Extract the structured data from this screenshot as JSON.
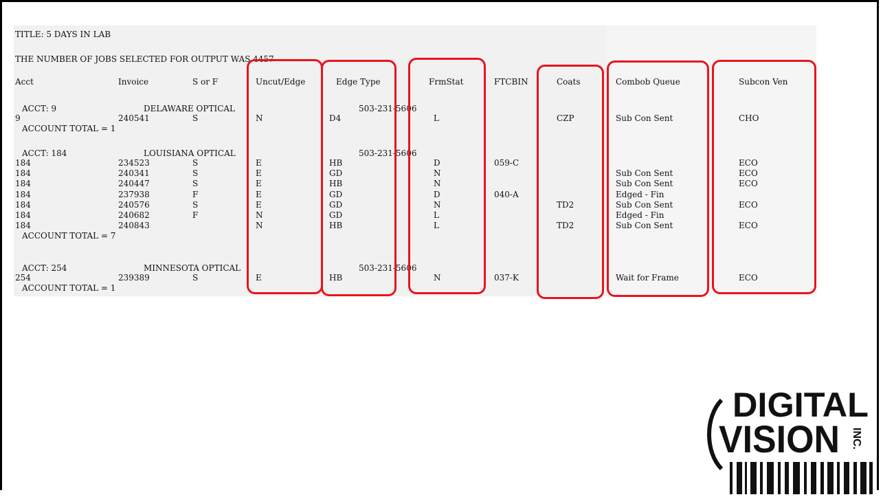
{
  "report": {
    "title": "TITLE: 5 DAYS IN LAB",
    "count_line": "THE NUMBER OF JOBS SELECTED FOR OUTPUT WAS 4457",
    "headers": {
      "acct": "Acct",
      "invoice": "Invoice",
      "sorf": "S or F",
      "uncut": "Uncut/Edge",
      "edge_type": "Edge Type",
      "frmstat": "FrmStat",
      "ftcbin": "FTCBIN",
      "coats": "Coats",
      "combob": "Combob Queue",
      "subcon": "Subcon Ven"
    },
    "groups": [
      {
        "acct_label": "ACCT: 9",
        "name": "DELAWARE OPTICAL",
        "phone": "503-231-5606",
        "total": "ACCOUNT TOTAL = 1",
        "rows": [
          {
            "acct": "9",
            "invoice": "240541",
            "sorf": "S",
            "uncut": "N",
            "edge": "D4",
            "frm": "L",
            "ftc": "",
            "coats": "CZP",
            "combob": "Sub Con Sent",
            "subcon": "CHO"
          }
        ]
      },
      {
        "acct_label": "ACCT: 184",
        "name": "LOUISIANA OPTICAL",
        "phone": "503-231-5606",
        "total": "ACCOUNT TOTAL = 7",
        "rows": [
          {
            "acct": "184",
            "invoice": "234523",
            "sorf": "S",
            "uncut": "E",
            "edge": "HB",
            "frm": "D",
            "ftc": "059-C",
            "coats": "",
            "combob": "",
            "subcon": "ECO"
          },
          {
            "acct": "184",
            "invoice": "240341",
            "sorf": "S",
            "uncut": "E",
            "edge": "GD",
            "frm": "N",
            "ftc": "",
            "coats": "",
            "combob": "Sub Con Sent",
            "subcon": "ECO"
          },
          {
            "acct": "184",
            "invoice": "240447",
            "sorf": "S",
            "uncut": "E",
            "edge": "HB",
            "frm": "N",
            "ftc": "",
            "coats": "",
            "combob": "Sub Con Sent",
            "subcon": "ECO"
          },
          {
            "acct": "184",
            "invoice": "237938",
            "sorf": "F",
            "uncut": "E",
            "edge": "GD",
            "frm": "D",
            "ftc": "040-A",
            "coats": "",
            "combob": "Edged - Fin",
            "subcon": ""
          },
          {
            "acct": "184",
            "invoice": "240576",
            "sorf": "S",
            "uncut": "E",
            "edge": "GD",
            "frm": "N",
            "ftc": "",
            "coats": "TD2",
            "combob": "Sub Con Sent",
            "subcon": "ECO"
          },
          {
            "acct": "184",
            "invoice": "240682",
            "sorf": "F",
            "uncut": "N",
            "edge": "GD",
            "frm": "L",
            "ftc": "",
            "coats": "",
            "combob": "Edged - Fin",
            "subcon": ""
          },
          {
            "acct": "184",
            "invoice": "240843",
            "sorf": "",
            "uncut": "N",
            "edge": "HB",
            "frm": "L",
            "ftc": "",
            "coats": "TD2",
            "combob": "Sub Con Sent",
            "subcon": "ECO"
          }
        ]
      },
      {
        "acct_label": "ACCT: 254",
        "name": "MINNESOTA OPTICAL",
        "phone": "503-231-5606",
        "total": "ACCOUNT TOTAL = 1",
        "rows": [
          {
            "acct": "254",
            "invoice": "239389",
            "sorf": "S",
            "uncut": "E",
            "edge": "HB",
            "frm": "N",
            "ftc": "037-K",
            "coats": "",
            "combob": "Wait for Frame",
            "subcon": "ECO"
          }
        ]
      }
    ]
  },
  "highlight_color": "#e8141c",
  "logo": {
    "line1": "DIGITAL",
    "line2": "VISION",
    "suffix": "INC.",
    "color": "#111111"
  }
}
